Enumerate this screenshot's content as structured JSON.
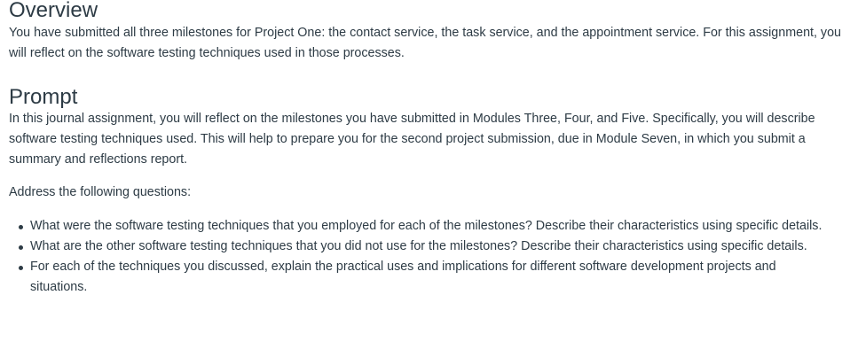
{
  "overview": {
    "heading": "Overview",
    "text": "You have submitted all three milestones for Project One: the contact service, the task service, and the appointment service. For this assignment, you will reflect on the software testing techniques used in those processes."
  },
  "prompt": {
    "heading": "Prompt",
    "text": "In this journal assignment, you will reflect on the milestones you have submitted in Modules Three, Four, and Five. Specifically, you will describe software testing techniques used. This will help to prepare you for the second project submission, due in Module Seven, in which you submit a summary and reflections report.",
    "address_text": "Address the following questions:",
    "questions": [
      "What were the software testing techniques that you employed for each of the milestones? Describe their characteristics using specific details.",
      "What are the other software testing techniques that you did not use for the milestones? Describe their characteristics using specific details.",
      "For each of the techniques you discussed, explain the practical uses and implications for different software development projects and situations."
    ]
  }
}
